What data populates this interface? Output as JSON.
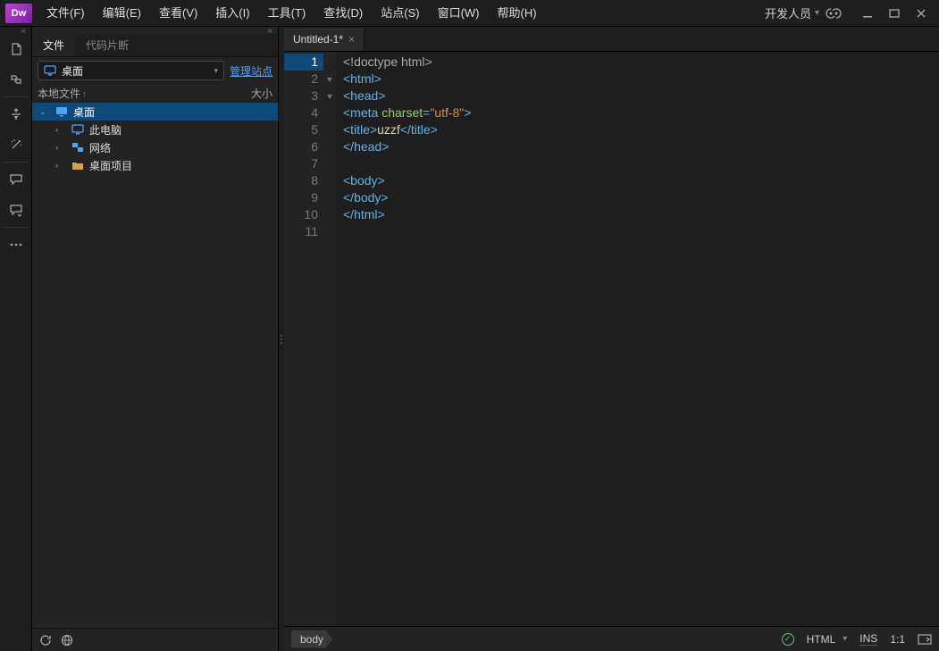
{
  "logo": "Dw",
  "menu": [
    "文件(F)",
    "编辑(E)",
    "查看(V)",
    "插入(I)",
    "工具(T)",
    "查找(D)",
    "站点(S)",
    "窗口(W)",
    "帮助(H)"
  ],
  "workspace": "开发人员",
  "panel": {
    "tabs": [
      "文件",
      "代码片断"
    ],
    "dropdown": "桌面",
    "manage_sites": "管理站点",
    "col1": "本地文件",
    "col2": "大小",
    "tree": [
      {
        "label": "桌面",
        "icon": "desktop",
        "depth": 0,
        "arrow": "v",
        "selected": true
      },
      {
        "label": "此电脑",
        "icon": "computer",
        "depth": 1,
        "arrow": ">"
      },
      {
        "label": "网络",
        "icon": "network",
        "depth": 1,
        "arrow": ">"
      },
      {
        "label": "桌面项目",
        "icon": "folder",
        "depth": 1,
        "arrow": ">"
      }
    ]
  },
  "file_tab": "Untitled-1*",
  "code_lines": [
    {
      "n": 1,
      "fold": "",
      "html": "<span class='t-doctype'>&lt;!doctype html&gt;</span>"
    },
    {
      "n": 2,
      "fold": "▼",
      "html": "<span class='t-tag'>&lt;html&gt;</span>"
    },
    {
      "n": 3,
      "fold": "▼",
      "html": "<span class='t-tag'>&lt;head&gt;</span>"
    },
    {
      "n": 4,
      "fold": "",
      "html": "<span class='t-tag'>&lt;meta</span> <span class='t-attr'>charset</span><span class='t-tag'>=</span><span class='t-str'>\"utf-8\"</span><span class='t-tag'>&gt;</span>"
    },
    {
      "n": 5,
      "fold": "",
      "html": "<span class='t-tag'>&lt;title&gt;</span><span class='t-txt'>uzzf</span><span class='t-tag'>&lt;/title&gt;</span>"
    },
    {
      "n": 6,
      "fold": "",
      "html": "<span class='t-tag'>&lt;/head&gt;</span>"
    },
    {
      "n": 7,
      "fold": "",
      "html": ""
    },
    {
      "n": 8,
      "fold": "",
      "html": "<span class='t-tag'>&lt;body&gt;</span>"
    },
    {
      "n": 9,
      "fold": "",
      "html": "<span class='t-tag'>&lt;/body&gt;</span>"
    },
    {
      "n": 10,
      "fold": "",
      "html": "<span class='t-tag'>&lt;/html&gt;</span>"
    },
    {
      "n": 11,
      "fold": "",
      "html": ""
    }
  ],
  "breadcrumb": "body",
  "status": {
    "lang": "HTML",
    "ins": "INS",
    "pos": "1:1"
  }
}
